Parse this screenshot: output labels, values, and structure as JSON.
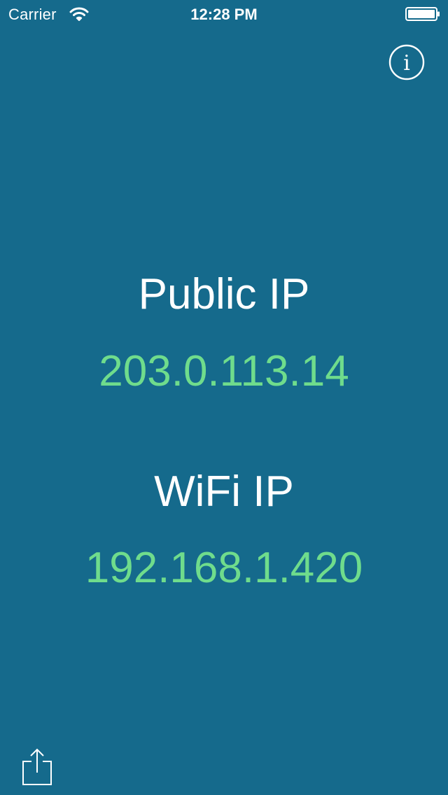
{
  "status_bar": {
    "carrier": "Carrier",
    "time": "12:28 PM",
    "icons": [
      "wifi-icon",
      "battery-icon"
    ]
  },
  "toolbar": {
    "info_icon": "info-icon",
    "share_icon": "share-icon"
  },
  "public_ip": {
    "label": "Public IP",
    "value": "203.0.113.14"
  },
  "wifi_ip": {
    "label": "WiFi IP",
    "value": "192.168.1.420"
  },
  "colors": {
    "background": "#156a8c",
    "label_text": "#ffffff",
    "ip_value_text": "#6fdc8c"
  }
}
